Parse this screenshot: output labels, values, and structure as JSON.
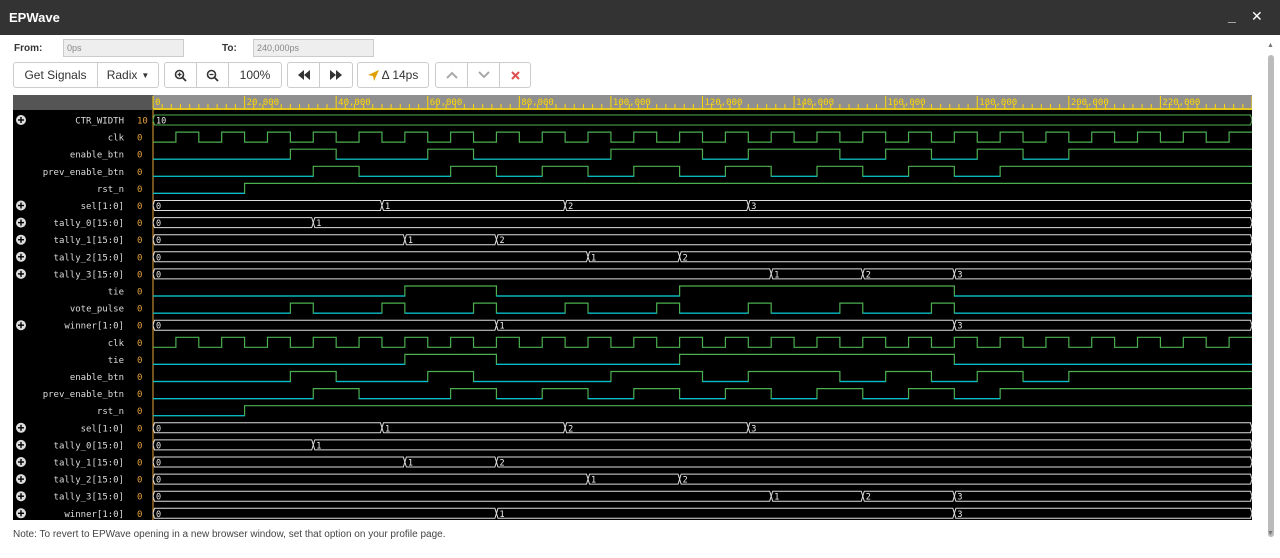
{
  "window": {
    "title": "EPWave",
    "minimize_label": "_",
    "close_label": "✕"
  },
  "range": {
    "from_label": "From:",
    "from_value": "0ps",
    "to_label": "To:",
    "to_value": "240,000ps"
  },
  "toolbar": {
    "get_signals": "Get Signals",
    "radix": "Radix",
    "zoom_level": "100%",
    "delta_label": "Δ 14ps",
    "icons": [
      "zoom-in-icon",
      "zoom-out-icon",
      "rewind-icon",
      "fast-forward-icon",
      "cursor-icon",
      "chevron-up-icon",
      "chevron-down-icon",
      "close-icon"
    ]
  },
  "timeline": {
    "max_ps": 240000,
    "ticks": [
      "0",
      "20,000",
      "40,000",
      "60,000",
      "80,000",
      "100,000",
      "120,000",
      "140,000",
      "160,000",
      "180,000",
      "200,000",
      "220,000"
    ],
    "tick_values": [
      0,
      20000,
      40000,
      60000,
      80000,
      100000,
      120000,
      140000,
      160000,
      180000,
      200000,
      220000
    ]
  },
  "signals": [
    {
      "name": "CTR_WIDTH",
      "value": "10",
      "type": "param",
      "expandable": true,
      "labels": [
        [
          "10",
          0
        ]
      ]
    },
    {
      "name": "clk",
      "value": "0",
      "type": "clock",
      "phase": 0
    },
    {
      "name": "enable_btn",
      "value": "0",
      "type": "bit",
      "edges": [
        [
          0,
          0
        ],
        [
          30000,
          1
        ],
        [
          40000,
          0
        ],
        [
          60000,
          1
        ],
        [
          70000,
          0
        ],
        [
          100000,
          1
        ],
        [
          120000,
          0
        ],
        [
          130000,
          1
        ],
        [
          150000,
          0
        ],
        [
          160000,
          1
        ],
        [
          170000,
          0
        ],
        [
          180000,
          1
        ],
        [
          190000,
          0
        ],
        [
          200000,
          1
        ]
      ]
    },
    {
      "name": "prev_enable_btn",
      "value": "0",
      "type": "bit",
      "edges": [
        [
          0,
          0
        ],
        [
          35000,
          1
        ],
        [
          45000,
          0
        ],
        [
          65000,
          1
        ],
        [
          75000,
          0
        ],
        [
          85000,
          1
        ],
        [
          95000,
          0
        ],
        [
          105000,
          1
        ],
        [
          115000,
          0
        ],
        [
          125000,
          1
        ],
        [
          135000,
          0
        ],
        [
          145000,
          1
        ],
        [
          155000,
          0
        ],
        [
          165000,
          1
        ],
        [
          175000,
          0
        ],
        [
          185000,
          1
        ]
      ]
    },
    {
      "name": "rst_n",
      "value": "0",
      "type": "bit",
      "edges": [
        [
          0,
          0
        ],
        [
          20000,
          1
        ]
      ]
    },
    {
      "name": "sel[1:0]",
      "value": "0",
      "type": "bus",
      "expandable": true,
      "labels": [
        [
          "0",
          0
        ],
        [
          "1",
          50000
        ],
        [
          "2",
          90000
        ],
        [
          "3",
          130000
        ]
      ]
    },
    {
      "name": "tally_0[15:0]",
      "value": "0",
      "type": "bus",
      "expandable": true,
      "labels": [
        [
          "0",
          0
        ],
        [
          "1",
          35000
        ]
      ]
    },
    {
      "name": "tally_1[15:0]",
      "value": "0",
      "type": "bus",
      "expandable": true,
      "labels": [
        [
          "0",
          0
        ],
        [
          "1",
          55000
        ],
        [
          "2",
          75000
        ]
      ]
    },
    {
      "name": "tally_2[15:0]",
      "value": "0",
      "type": "bus",
      "expandable": true,
      "labels": [
        [
          "0",
          0
        ],
        [
          "1",
          95000
        ],
        [
          "2",
          115000
        ]
      ]
    },
    {
      "name": "tally_3[15:0]",
      "value": "0",
      "type": "bus",
      "expandable": true,
      "labels": [
        [
          "0",
          0
        ],
        [
          "1",
          135000
        ],
        [
          "2",
          155000
        ],
        [
          "3",
          175000
        ]
      ]
    },
    {
      "name": "tie",
      "value": "0",
      "type": "bit",
      "edges": [
        [
          0,
          0
        ],
        [
          55000,
          1
        ],
        [
          75000,
          0
        ],
        [
          115000,
          1
        ],
        [
          175000,
          0
        ]
      ]
    },
    {
      "name": "vote_pulse",
      "value": "0",
      "type": "bit",
      "edges": [
        [
          0,
          0
        ],
        [
          30000,
          1
        ],
        [
          35000,
          0
        ],
        [
          50000,
          1
        ],
        [
          55000,
          0
        ],
        [
          70000,
          1
        ],
        [
          75000,
          0
        ],
        [
          90000,
          1
        ],
        [
          95000,
          0
        ],
        [
          110000,
          1
        ],
        [
          115000,
          0
        ],
        [
          130000,
          1
        ],
        [
          135000,
          0
        ],
        [
          150000,
          1
        ],
        [
          155000,
          0
        ],
        [
          170000,
          1
        ],
        [
          175000,
          0
        ]
      ]
    },
    {
      "name": "winner[1:0]",
      "value": "0",
      "type": "bus",
      "expandable": true,
      "labels": [
        [
          "0",
          0
        ],
        [
          "1",
          75000
        ],
        [
          "3",
          175000
        ]
      ]
    },
    {
      "name": "clk",
      "value": "0",
      "type": "clock",
      "phase": 0
    },
    {
      "name": "tie",
      "value": "0",
      "type": "bit",
      "edges": [
        [
          0,
          0
        ],
        [
          55000,
          1
        ],
        [
          75000,
          0
        ],
        [
          115000,
          1
        ],
        [
          175000,
          0
        ]
      ]
    },
    {
      "name": "enable_btn",
      "value": "0",
      "type": "bit",
      "edges": [
        [
          0,
          0
        ],
        [
          30000,
          1
        ],
        [
          40000,
          0
        ],
        [
          60000,
          1
        ],
        [
          70000,
          0
        ],
        [
          100000,
          1
        ],
        [
          120000,
          0
        ],
        [
          130000,
          1
        ],
        [
          150000,
          0
        ],
        [
          160000,
          1
        ],
        [
          170000,
          0
        ],
        [
          180000,
          1
        ],
        [
          190000,
          0
        ],
        [
          200000,
          1
        ]
      ]
    },
    {
      "name": "prev_enable_btn",
      "value": "0",
      "type": "bit",
      "edges": [
        [
          0,
          0
        ],
        [
          35000,
          1
        ],
        [
          45000,
          0
        ],
        [
          65000,
          1
        ],
        [
          75000,
          0
        ],
        [
          85000,
          1
        ],
        [
          95000,
          0
        ],
        [
          105000,
          1
        ],
        [
          115000,
          0
        ],
        [
          125000,
          1
        ],
        [
          135000,
          0
        ],
        [
          145000,
          1
        ],
        [
          155000,
          0
        ],
        [
          165000,
          1
        ],
        [
          175000,
          0
        ],
        [
          185000,
          1
        ]
      ]
    },
    {
      "name": "rst_n",
      "value": "0",
      "type": "bit",
      "edges": [
        [
          0,
          0
        ],
        [
          20000,
          1
        ]
      ]
    },
    {
      "name": "sel[1:0]",
      "value": "0",
      "type": "bus",
      "expandable": true,
      "labels": [
        [
          "0",
          0
        ],
        [
          "1",
          50000
        ],
        [
          "2",
          90000
        ],
        [
          "3",
          130000
        ]
      ]
    },
    {
      "name": "tally_0[15:0]",
      "value": "0",
      "type": "bus",
      "expandable": true,
      "labels": [
        [
          "0",
          0
        ],
        [
          "1",
          35000
        ]
      ]
    },
    {
      "name": "tally_1[15:0]",
      "value": "0",
      "type": "bus",
      "expandable": true,
      "labels": [
        [
          "0",
          0
        ],
        [
          "1",
          55000
        ],
        [
          "2",
          75000
        ]
      ]
    },
    {
      "name": "tally_2[15:0]",
      "value": "0",
      "type": "bus",
      "expandable": true,
      "labels": [
        [
          "0",
          0
        ],
        [
          "1",
          95000
        ],
        [
          "2",
          115000
        ]
      ]
    },
    {
      "name": "tally_3[15:0]",
      "value": "0",
      "type": "bus",
      "expandable": true,
      "labels": [
        [
          "0",
          0
        ],
        [
          "1",
          135000
        ],
        [
          "2",
          155000
        ],
        [
          "3",
          175000
        ]
      ]
    },
    {
      "name": "winner[1:0]",
      "value": "0",
      "type": "bus",
      "expandable": true,
      "labels": [
        [
          "0",
          0
        ],
        [
          "1",
          75000
        ],
        [
          "3",
          175000
        ]
      ]
    }
  ],
  "colors": {
    "wave_green": "#4caf50",
    "wave_cyan": "#00bcd4",
    "bus_line": "#dddddd",
    "ruler_yellow": "#ffd700",
    "value_orange": "#e8a33a"
  },
  "note": "Note: To revert to EPWave opening in a new browser window, set that option on your profile page."
}
